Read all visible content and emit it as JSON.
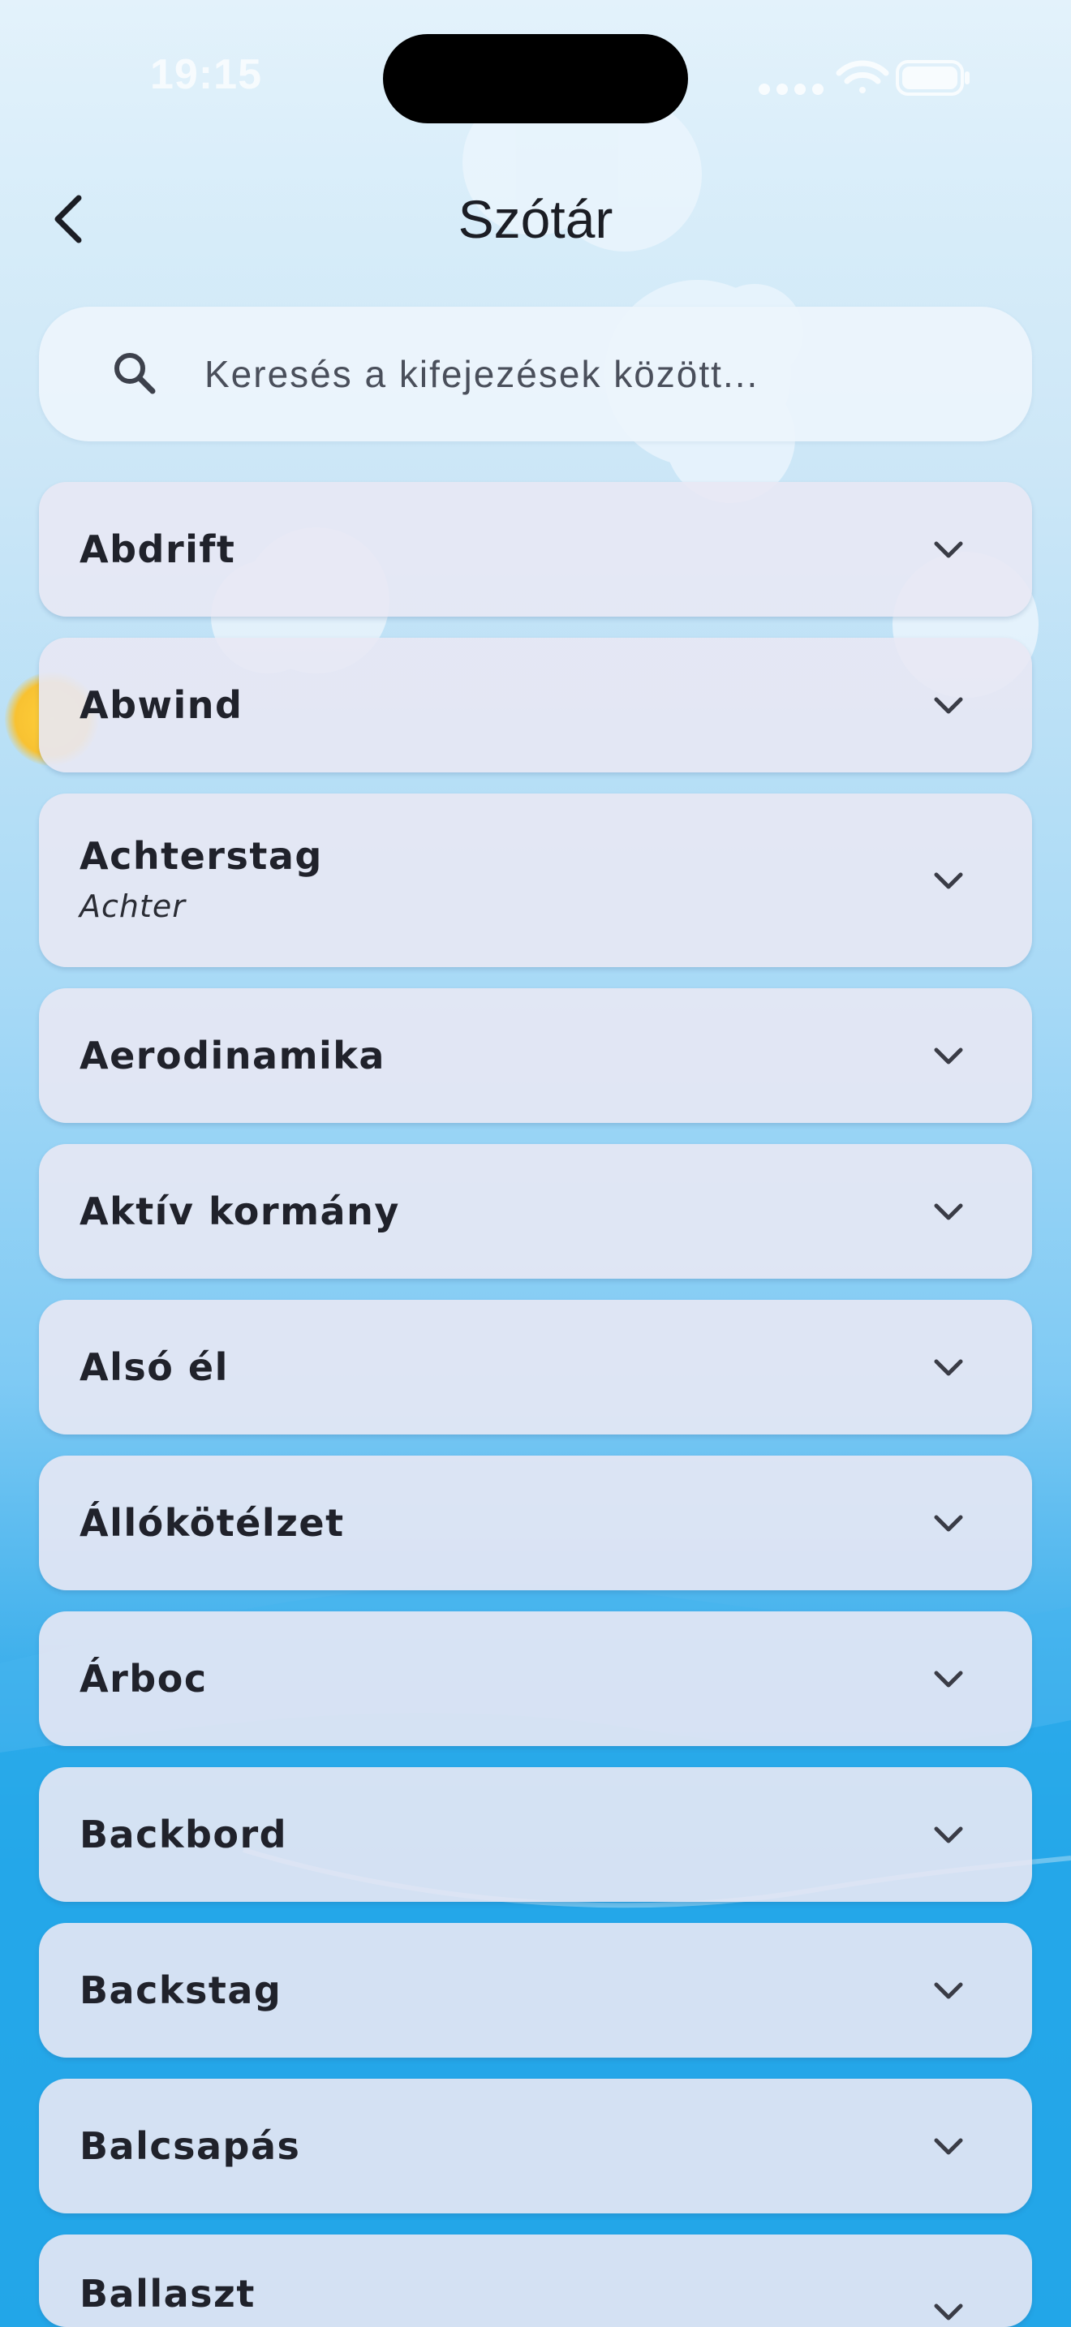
{
  "status_bar": {
    "time": "19:15"
  },
  "header": {
    "title": "Szótár",
    "back_icon": "chevron-left-icon"
  },
  "search": {
    "placeholder": "Keresés a kifejezések között...",
    "value": "",
    "icon": "search-icon"
  },
  "terms": [
    {
      "title": "Abdrift",
      "subtitle": ""
    },
    {
      "title": "Abwind",
      "subtitle": ""
    },
    {
      "title": "Achterstag",
      "subtitle": "Achter"
    },
    {
      "title": "Aerodinamika",
      "subtitle": ""
    },
    {
      "title": "Aktív kormány",
      "subtitle": ""
    },
    {
      "title": "Alsó él",
      "subtitle": ""
    },
    {
      "title": "Állókötélzet",
      "subtitle": ""
    },
    {
      "title": "Árboc",
      "subtitle": ""
    },
    {
      "title": "Backbord",
      "subtitle": ""
    },
    {
      "title": "Backstag",
      "subtitle": ""
    },
    {
      "title": "Balcsapás",
      "subtitle": ""
    },
    {
      "title": "Ballaszt",
      "subtitle": ""
    }
  ],
  "colors": {
    "sky_top": "#e3f2fb",
    "sea": "#0b98e0",
    "card": "#e8e8f4",
    "text": "#20222b",
    "sun": "#f8c232"
  }
}
